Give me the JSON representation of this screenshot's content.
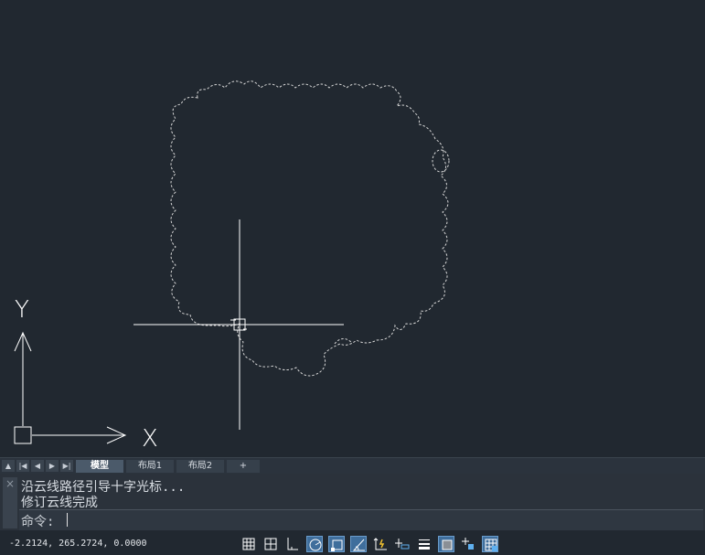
{
  "colors": {
    "canvas_background": "#212830",
    "drawing_lines": "#ffffff",
    "active_toggle": "#3f6e9c"
  },
  "canvas": {
    "ucs_y_label": "Y",
    "ucs_x_label": "X"
  },
  "layout_tabs": {
    "nav_buttons": [
      "▲",
      "|◀",
      "◀",
      "▶",
      "▶|"
    ],
    "tabs": [
      {
        "label": "模型",
        "active": true
      },
      {
        "label": "布局1",
        "active": false
      },
      {
        "label": "布局2",
        "active": false
      }
    ],
    "add_label": "+"
  },
  "command": {
    "close_label": "×",
    "history": [
      "沿云线路径引导十字光标...",
      "修订云线完成"
    ],
    "prompt": "命令:",
    "input_value": ""
  },
  "status": {
    "coordinates": "-2.2124, 265.2724, 0.0000",
    "toggles": [
      {
        "name": "grid-display-icon",
        "on": false
      },
      {
        "name": "snap-mode-icon",
        "on": false
      },
      {
        "name": "ortho-mode-icon",
        "on": false
      },
      {
        "name": "polar-tracking-icon",
        "on": true
      },
      {
        "name": "object-snap-icon",
        "on": true
      },
      {
        "name": "object-snap-tracking-icon",
        "on": true
      },
      {
        "name": "dynamic-ucs-icon",
        "on": false
      },
      {
        "name": "dynamic-input-icon",
        "on": false
      },
      {
        "name": "lineweight-icon",
        "on": false
      },
      {
        "name": "transparency-icon",
        "on": true
      },
      {
        "name": "selection-cycling-icon",
        "on": false
      },
      {
        "name": "annotation-monitor-icon",
        "on": true
      }
    ]
  }
}
